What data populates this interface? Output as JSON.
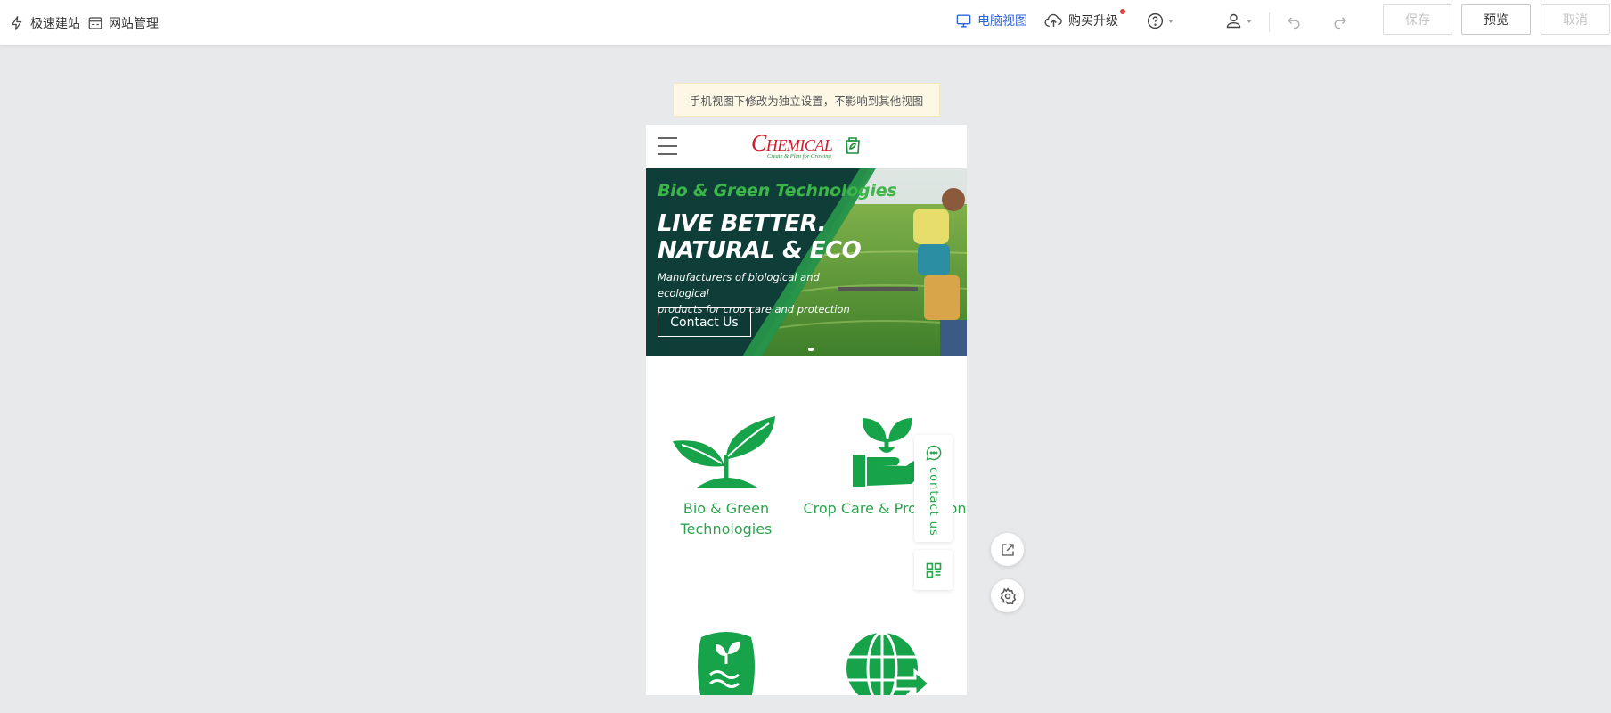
{
  "toolbar": {
    "quick_build": "极速建站",
    "site_manage": "网站管理",
    "desktop_view": "电脑视图",
    "upgrade": "购买升级",
    "save": "保存",
    "preview": "预览",
    "cancel": "取消"
  },
  "notice": "手机视图下修改为独立设置，不影响到其他视图",
  "logo": {
    "initial": "C",
    "rest": "HEMICAL",
    "tagline": "Create & Plan for Growing"
  },
  "hero": {
    "subtitle": "Bio & Green Technologies",
    "title_line1": "LIVE BETTER.",
    "title_line2": "NATURAL & ECO",
    "desc_line1": "Manufacturers of biological and ecological",
    "desc_line2": "products for crop care and protection",
    "button": "Contact Us"
  },
  "features": [
    {
      "line1": "Bio & Green",
      "line2": "Technologies"
    },
    {
      "line1": "Crop Care & Protection",
      "line2": ""
    }
  ],
  "float": {
    "contact": "contact us"
  },
  "colors": {
    "accent_green": "#2aa44e",
    "desktop_view_blue": "#2b62d9",
    "logo_red": "#d01c2a"
  }
}
